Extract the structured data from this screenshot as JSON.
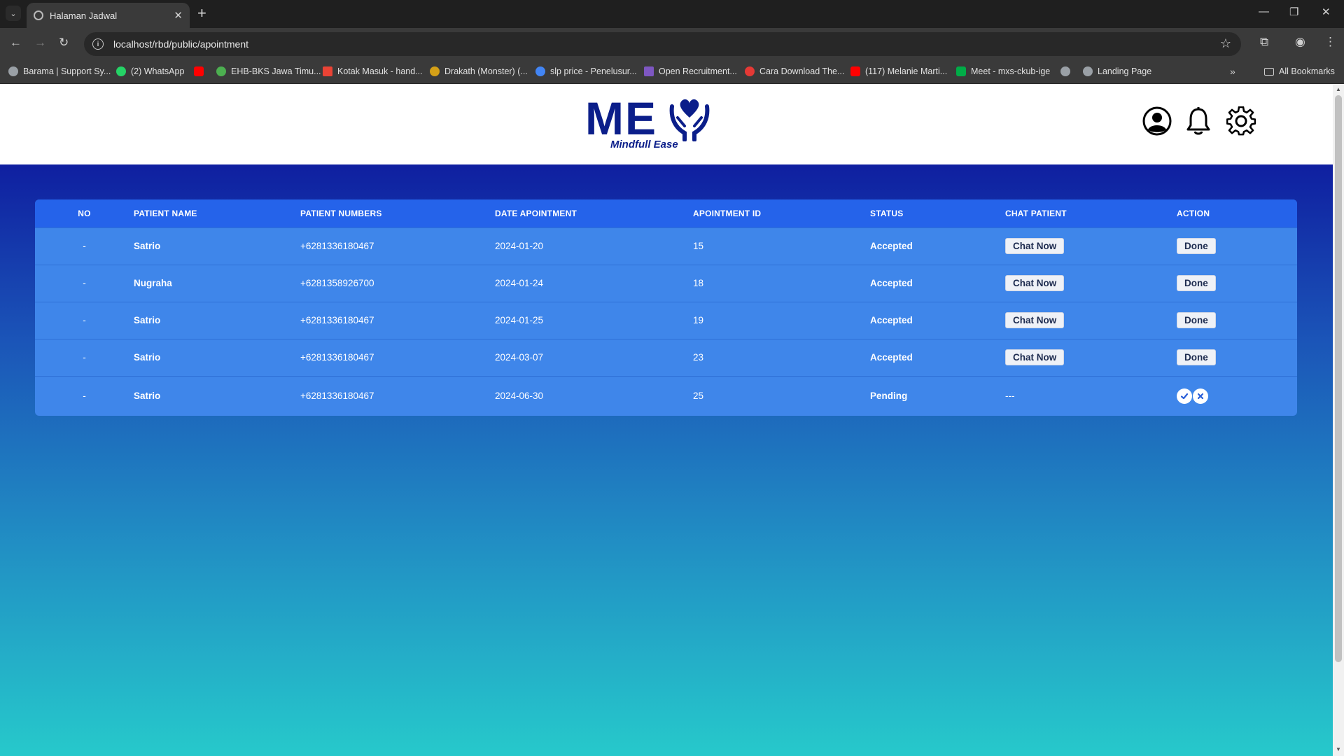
{
  "browser": {
    "tab_title": "Halaman Jadwal",
    "url": "localhost/rbd/public/apointment",
    "bookmarks": [
      {
        "label": "Barama | Support Sy...",
        "color": "#9aa0a6"
      },
      {
        "label": "(2) WhatsApp",
        "color": "#25d366"
      },
      {
        "label": "",
        "color": "#ff0000"
      },
      {
        "label": "EHB-BKS Jawa Timu...",
        "color": "#4caf50"
      },
      {
        "label": "Kotak Masuk - hand...",
        "color": "#ea4335"
      },
      {
        "label": "Drakath (Monster) (...",
        "color": "#d4a017"
      },
      {
        "label": "slp price - Penelusur...",
        "color": "#4285f4"
      },
      {
        "label": "Open Recruitment...",
        "color": "#7e57c2"
      },
      {
        "label": "Cara Download The...",
        "color": "#e53935"
      },
      {
        "label": "(117) Melanie Marti...",
        "color": "#ff0000"
      },
      {
        "label": "Meet - mxs-ckub-ige",
        "color": "#00ac47"
      },
      {
        "label": "",
        "color": "#9aa0a6"
      },
      {
        "label": "Landing Page",
        "color": "#9aa0a6"
      }
    ],
    "all_bookmarks": "All Bookmarks"
  },
  "header": {
    "logo_text": "ME",
    "logo_tagline": "Mindfull Ease",
    "icons": [
      "user-circle-icon",
      "bell-icon",
      "gear-icon"
    ]
  },
  "table": {
    "headers": {
      "no": "NO",
      "name": "PATIENT NAME",
      "numbers": "PATIENT NUMBERS",
      "date": "DATE APOINTMENT",
      "id": "APOINTMENT ID",
      "status": "STATUS",
      "chat": "CHAT PATIENT",
      "action": "ACTION"
    },
    "rows": [
      {
        "no": "-",
        "name": "Satrio",
        "number": "+6281336180467",
        "date": "2024-01-20",
        "id": "15",
        "status": "Accepted",
        "chat": "Chat Now",
        "action": "Done"
      },
      {
        "no": "-",
        "name": "Nugraha",
        "number": "+6281358926700",
        "date": "2024-01-24",
        "id": "18",
        "status": "Accepted",
        "chat": "Chat Now",
        "action": "Done"
      },
      {
        "no": "-",
        "name": "Satrio",
        "number": "+6281336180467",
        "date": "2024-01-25",
        "id": "19",
        "status": "Accepted",
        "chat": "Chat Now",
        "action": "Done"
      },
      {
        "no": "-",
        "name": "Satrio",
        "number": "+6281336180467",
        "date": "2024-03-07",
        "id": "23",
        "status": "Accepted",
        "chat": "Chat Now",
        "action": "Done"
      },
      {
        "no": "-",
        "name": "Satrio",
        "number": "+6281336180467",
        "date": "2024-06-30",
        "id": "25",
        "status": "Pending",
        "chat": "---",
        "action": ""
      }
    ]
  },
  "colors": {
    "brand": "#0b1e8a",
    "table_header": "#2563ea",
    "table_body": "#3f86ea"
  }
}
